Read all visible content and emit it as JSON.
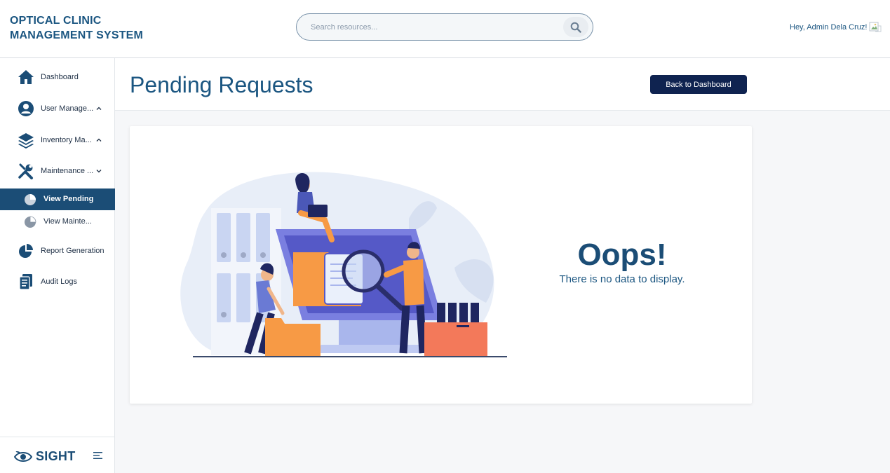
{
  "app": {
    "brand_line1": "OPTICAL CLINIC",
    "brand_line2": "MANAGEMENT SYSTEM",
    "logo_text": "SIGHT"
  },
  "header": {
    "search_placeholder": "Search resources...",
    "search_icon": "search-icon",
    "greeting": "Hey, Admin Dela Cruz!",
    "avatar_icon": "broken-image-icon"
  },
  "sidebar": {
    "items": [
      {
        "label": "Dashboard",
        "icon": "home-icon"
      },
      {
        "label": "User Manage...",
        "icon": "user-circle-icon",
        "chevron": "chevron-up-icon"
      },
      {
        "label": "Inventory Ma...",
        "icon": "layers-icon",
        "chevron": "chevron-up-icon"
      },
      {
        "label": "Maintenance ...",
        "icon": "tools-icon",
        "chevron": "chevron-down-icon"
      },
      {
        "label": "Report Generation",
        "icon": "pie-chart-icon"
      },
      {
        "label": "Audit Logs",
        "icon": "clipboard-icon"
      }
    ],
    "subitems": [
      {
        "label": "View Pending",
        "icon": "pie-chart-icon",
        "active": true
      },
      {
        "label": "View Mainte...",
        "icon": "pie-chart-icon",
        "active": false
      }
    ],
    "menu_icon": "hamburger-icon"
  },
  "main": {
    "title": "Pending Requests",
    "back_button": "Back to Dashboard",
    "empty_title": "Oops!",
    "empty_message": "There is no data to display."
  },
  "colors": {
    "primary": "#1b5681",
    "nav_active_bg": "#1b4d76",
    "button_bg": "#0f2350",
    "illustration_orange": "#f79a45",
    "illustration_purple": "#6f73d6"
  }
}
